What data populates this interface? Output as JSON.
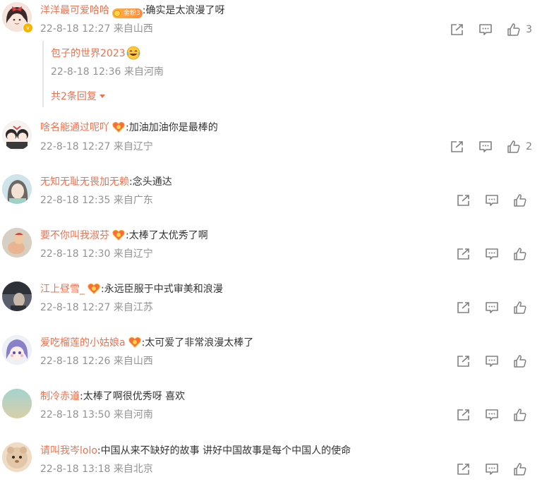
{
  "comments": [
    {
      "username": "洋洋最可爱哈哈",
      "badge": "medal",
      "badge_text": "金粉3",
      "text": ":确实是太浪漫了呀",
      "meta": "22-8-18 12:27 来自山西",
      "likes": "3",
      "verified": "v",
      "avatar_colors": [
        "#f4e4dc",
        "#3a2a2a",
        "#e23c3c"
      ]
    },
    {
      "username": "啥名能通过呢吖",
      "badge": "heart",
      "text": ":加油加油你是最棒的",
      "meta": "22-8-18 12:27 来自辽宁",
      "likes": "2",
      "avatar_colors": [
        "#f7f2f0",
        "#2b2b2b",
        "#d44a4a"
      ]
    },
    {
      "username": "无知无耻无畏加无赖",
      "badge": "",
      "text": ":念头通达",
      "meta": "22-8-18 12:35 来自广东",
      "likes": "",
      "avatar_colors": [
        "#cfe3ea",
        "#6d6a66",
        "#9fd2c6"
      ]
    },
    {
      "username": "要不你叫我淑芬",
      "badge": "heart",
      "text": ":太棒了太优秀了啊",
      "meta": "22-8-18 12:30 来自辽宁",
      "likes": "",
      "avatar_colors": [
        "#d6cfc2",
        "#e8b590",
        "#c94b3c"
      ]
    },
    {
      "username": "江上昼雪_",
      "badge": "heart",
      "text": ":永远臣服于中式审美和浪漫",
      "meta": "22-8-18 12:27 来自江苏",
      "likes": "",
      "avatar_colors": [
        "#5a5f6b",
        "#c7b8a8",
        "#2e3138"
      ]
    },
    {
      "username": "爱吃榴莲的小姑娘a",
      "badge": "heart",
      "text": ":太可爱了非常浪漫太棒了",
      "meta": "22-8-18 12:26 来自山西",
      "likes": "",
      "avatar_colors": [
        "#eef0f8",
        "#8a7fc9",
        "#f1b6c6"
      ]
    },
    {
      "username": "制冷赤道",
      "badge": "",
      "text": ":太棒了啊很优秀呀 喜欢",
      "meta": "22-8-18 13:50 来自河南",
      "likes": "",
      "avatar_colors": [
        "#bfe3d0",
        "#d9cfa8",
        "#a3d4cf"
      ]
    },
    {
      "username": "请叫我岑lolo",
      "badge": "",
      "text": ":中国从来不缺好的故事 讲好中国故事是每个中国人的使命",
      "meta": "22-8-18 13:18 来自北京",
      "likes": "",
      "avatar_colors": [
        "#e2c7a8",
        "#a8744a",
        "#f0dcc4"
      ]
    }
  ],
  "reply": {
    "username": "包子的世界2023",
    "meta": "22-8-18 12:36 来自河南",
    "more_label": "共2条回复",
    "emoji": "laughing-emoji"
  },
  "colors": {
    "username": "#eb7350",
    "meta": "#939393",
    "icon": "#808080"
  }
}
